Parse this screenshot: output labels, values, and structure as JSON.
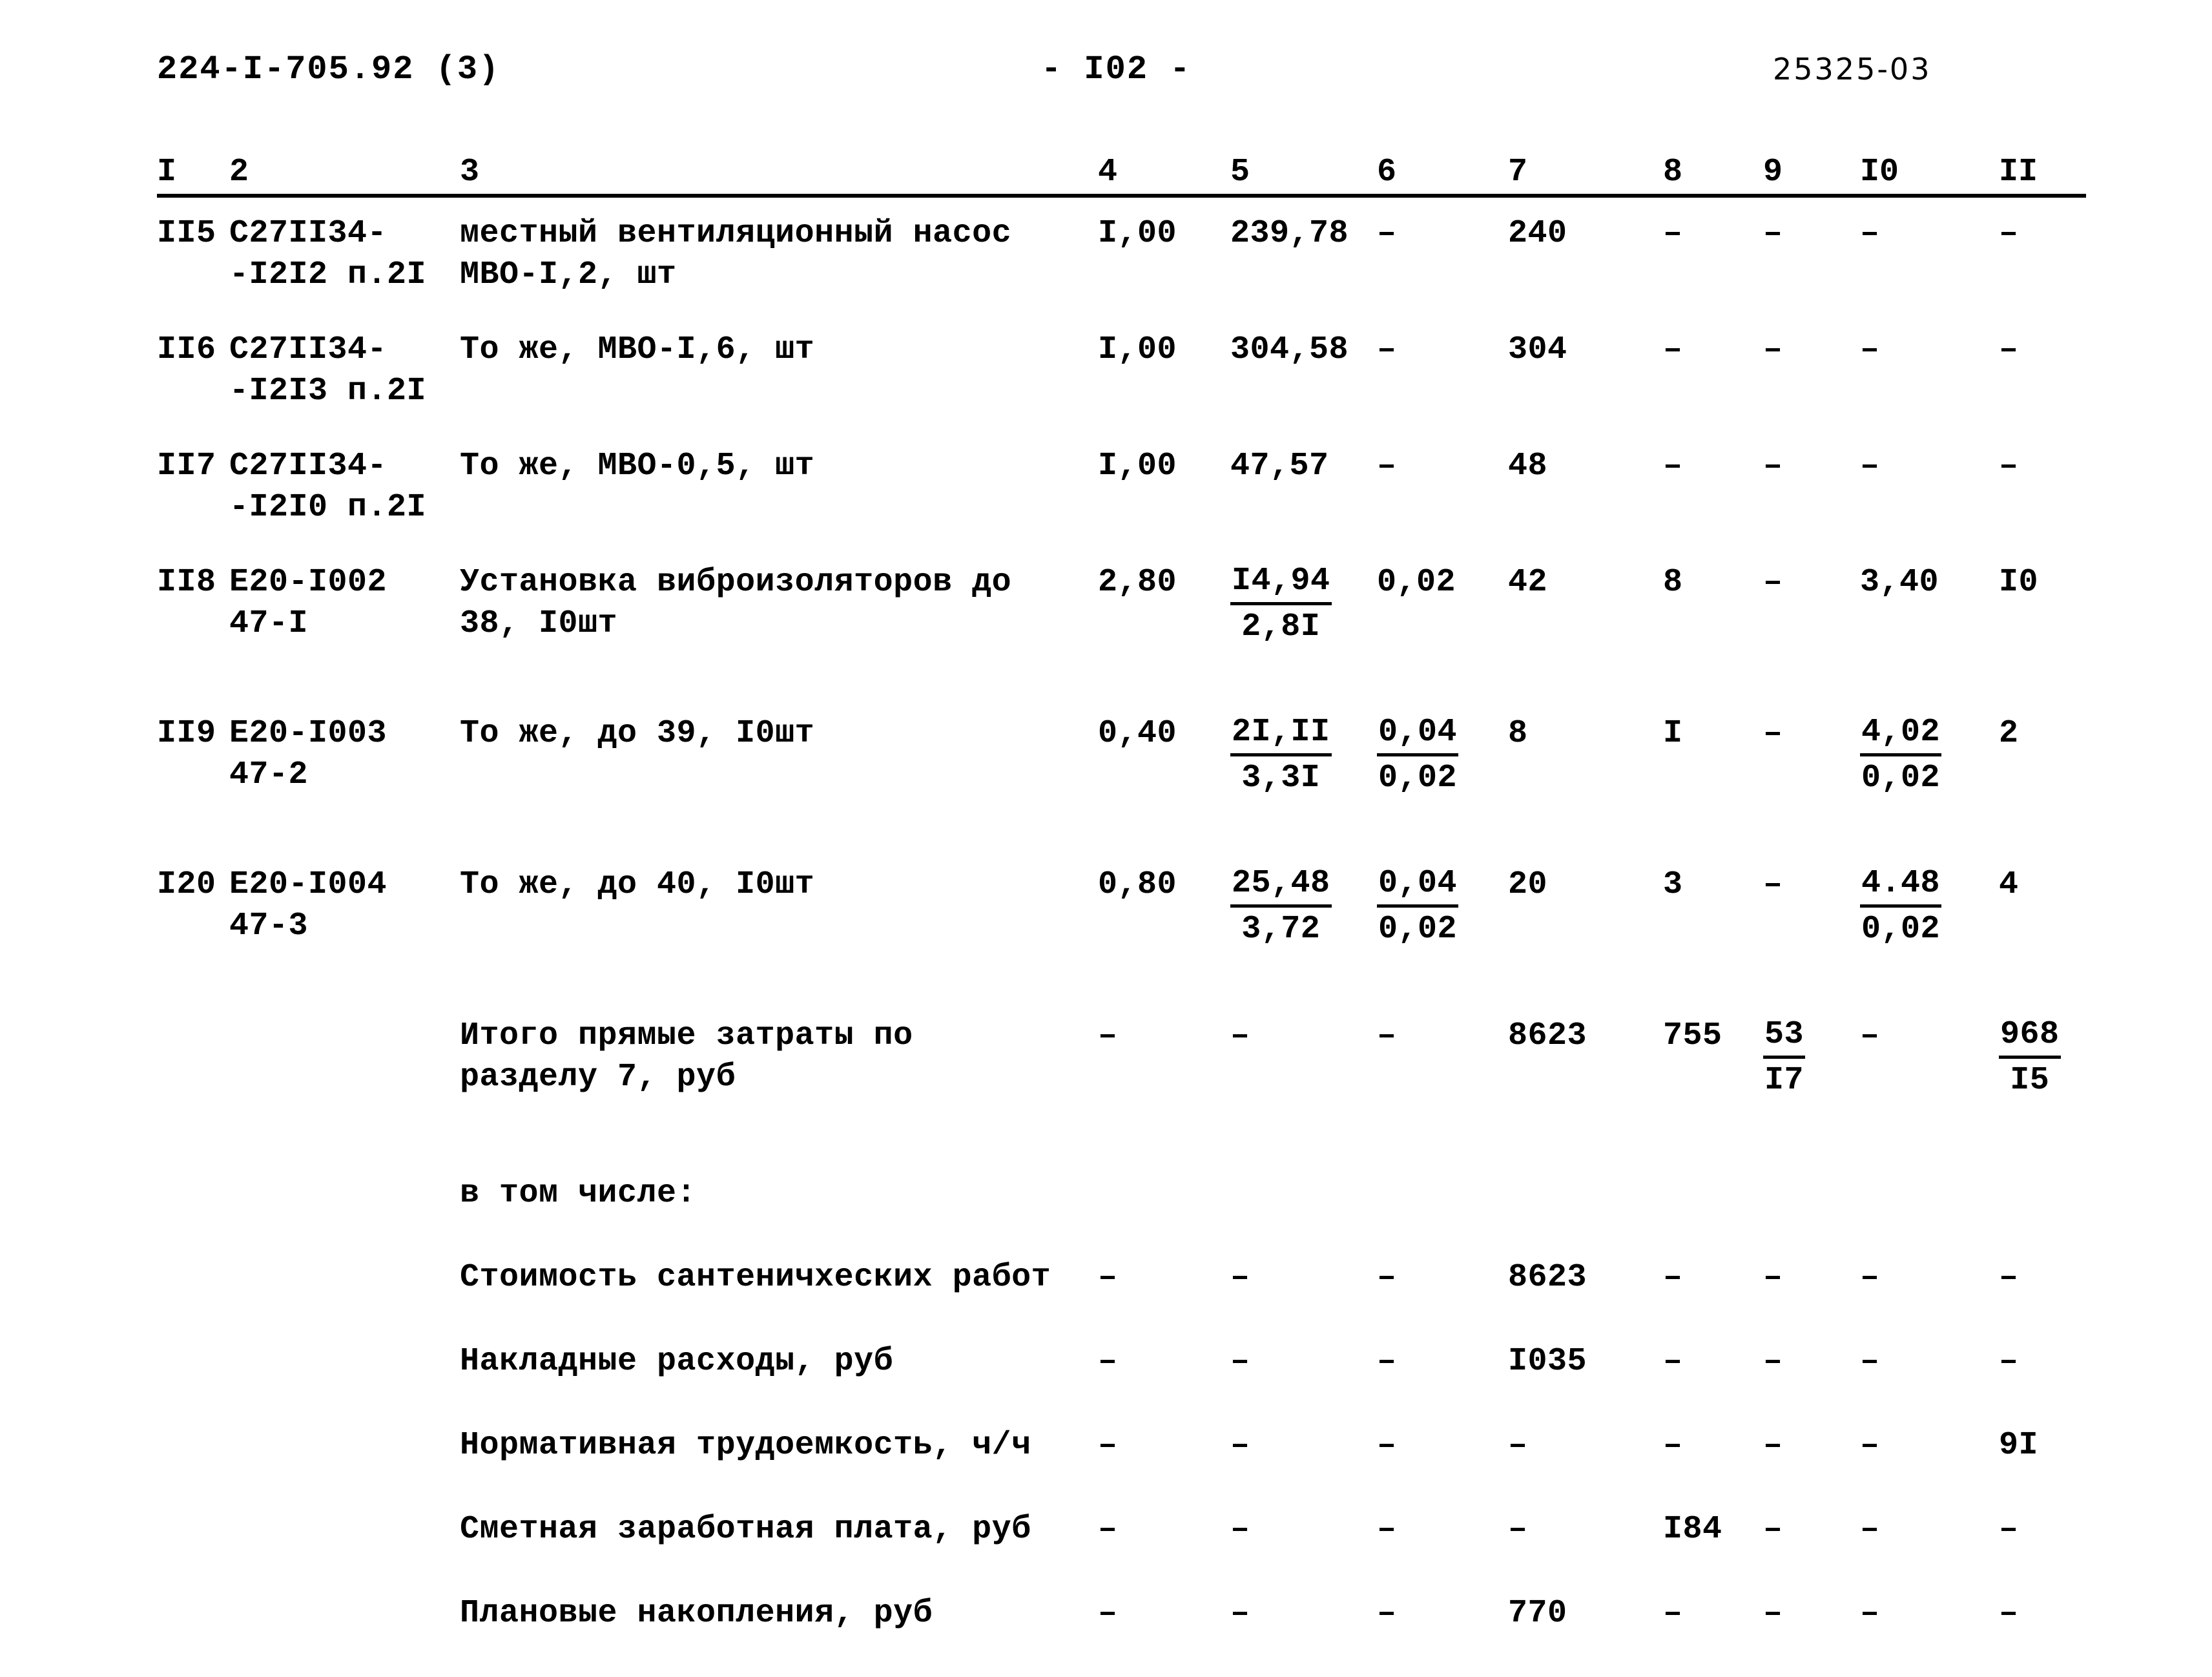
{
  "header": {
    "doc_code": "224-I-705.92 (3)",
    "page_marker": "- I02 -",
    "stamp_code": "25325-03"
  },
  "table": {
    "column_numbers": [
      "I",
      "2",
      "3",
      "4",
      "5",
      "6",
      "7",
      "8",
      "9",
      "I0",
      "II"
    ],
    "rows": [
      {
        "num": "II5",
        "code_l1": "С27II34-",
        "code_l2": "-I2I2 п.2I",
        "desc_l1": "местный вентиляционный насос",
        "desc_l2": "МВО-I,2, шт",
        "c4": "I,00",
        "c5_num": "239,78",
        "c5_den": "",
        "c6_num": "–",
        "c6_den": "",
        "c7": "240",
        "c8": "–",
        "c9_num": "–",
        "c9_den": "",
        "c10_num": "–",
        "c10_den": "",
        "c11_num": "–",
        "c11_den": ""
      },
      {
        "num": "II6",
        "code_l1": "С27II34-",
        "code_l2": "-I2I3 п.2I",
        "desc_l1": "То же, МВО-I,6, шт",
        "desc_l2": "",
        "c4": "I,00",
        "c5_num": "304,58",
        "c5_den": "",
        "c6_num": "–",
        "c6_den": "",
        "c7": "304",
        "c8": "–",
        "c9_num": "–",
        "c9_den": "",
        "c10_num": "–",
        "c10_den": "",
        "c11_num": "–",
        "c11_den": ""
      },
      {
        "num": "II7",
        "code_l1": "С27II34-",
        "code_l2": "-I2I0 п.2I",
        "desc_l1": "То же, МВО-0,5, шт",
        "desc_l2": "",
        "c4": "I,00",
        "c5_num": "47,57",
        "c5_den": "",
        "c6_num": "–",
        "c6_den": "",
        "c7": "48",
        "c8": "–",
        "c9_num": "–",
        "c9_den": "",
        "c10_num": "–",
        "c10_den": "",
        "c11_num": "–",
        "c11_den": ""
      },
      {
        "num": "II8",
        "code_l1": "Е20-I002",
        "code_l2": "47-I",
        "desc_l1": "Установка виброизоляторов до",
        "desc_l2": "38, I0шт",
        "c4": "2,80",
        "c5_num": "I4,94",
        "c5_den": "2,8I",
        "c6_num": "0,02",
        "c6_den": "",
        "c7": "42",
        "c8": "8",
        "c9_num": "–",
        "c9_den": "",
        "c10_num": "3,40",
        "c10_den": "",
        "c11_num": "I0",
        "c11_den": ""
      },
      {
        "num": "II9",
        "code_l1": "Е20-I003",
        "code_l2": "47-2",
        "desc_l1": "То же, до 39, I0шт",
        "desc_l2": "",
        "c4": "0,40",
        "c5_num": "2I,II",
        "c5_den": "3,3I",
        "c6_num": "0,04",
        "c6_den": "0,02",
        "c7": "8",
        "c8": "I",
        "c9_num": "–",
        "c9_den": "",
        "c10_num": "4,02",
        "c10_den": "0,02",
        "c11_num": "2",
        "c11_den": ""
      },
      {
        "num": "I20",
        "code_l1": "Е20-I004",
        "code_l2": "47-3",
        "desc_l1": "То же, до 40, I0шт",
        "desc_l2": "",
        "c4": "0,80",
        "c5_num": "25,48",
        "c5_den": "3,72",
        "c6_num": "0,04",
        "c6_den": "0,02",
        "c7": "20",
        "c8": "3",
        "c9_num": "–",
        "c9_den": "",
        "c10_num": "4.48",
        "c10_den": "0,02",
        "c11_num": "4",
        "c11_den": ""
      }
    ],
    "summary_rows": [
      {
        "label_l1": "Итого прямые затраты по",
        "label_l2": "разделу 7, руб",
        "c4": "–",
        "c5_num": "–",
        "c5_den": "",
        "c6_num": "–",
        "c6_den": "",
        "c7": "8623",
        "c8": "755",
        "c9_num": "53",
        "c9_den": "I7",
        "c10_num": "–",
        "c10_den": "",
        "c11_num": "968",
        "c11_den": "I5"
      },
      {
        "label_l1": "в том числе:",
        "label_l2": "",
        "c4": "",
        "c5_num": "",
        "c5_den": "",
        "c6_num": "",
        "c6_den": "",
        "c7": "",
        "c8": "",
        "c9_num": "",
        "c9_den": "",
        "c10_num": "",
        "c10_den": "",
        "c11_num": "",
        "c11_den": ""
      },
      {
        "label_l1": "Стоимость сантеничхеских работ",
        "label_l2": "",
        "c4": "–",
        "c5_num": "–",
        "c5_den": "",
        "c6_num": "–",
        "c6_den": "",
        "c7": "8623",
        "c8": "–",
        "c9_num": "–",
        "c9_den": "",
        "c10_num": "–",
        "c10_den": "",
        "c11_num": "–",
        "c11_den": ""
      },
      {
        "label_l1": "Накладные расходы, руб",
        "label_l2": "",
        "c4": "–",
        "c5_num": "–",
        "c5_den": "",
        "c6_num": "–",
        "c6_den": "",
        "c7": "I035",
        "c8": "–",
        "c9_num": "–",
        "c9_den": "",
        "c10_num": "–",
        "c10_den": "",
        "c11_num": "–",
        "c11_den": ""
      },
      {
        "label_l1": "Нормативная трудоемкость, ч/ч",
        "label_l2": "",
        "c4": "–",
        "c5_num": "–",
        "c5_den": "",
        "c6_num": "–",
        "c6_den": "",
        "c7": "–",
        "c8": "–",
        "c9_num": "–",
        "c9_den": "",
        "c10_num": "–",
        "c10_den": "",
        "c11_num": "9I",
        "c11_den": ""
      },
      {
        "label_l1": "Сметная заработная плата, руб",
        "label_l2": "",
        "c4": "–",
        "c5_num": "–",
        "c5_den": "",
        "c6_num": "–",
        "c6_den": "",
        "c7": "–",
        "c8": "I84",
        "c9_num": "–",
        "c9_den": "",
        "c10_num": "–",
        "c10_den": "",
        "c11_num": "–",
        "c11_den": ""
      },
      {
        "label_l1": "Плановые накопления, руб",
        "label_l2": "",
        "c4": "–",
        "c5_num": "–",
        "c5_den": "",
        "c6_num": "–",
        "c6_den": "",
        "c7": "770",
        "c8": "–",
        "c9_num": "–",
        "c9_den": "",
        "c10_num": "–",
        "c10_den": "",
        "c11_num": "–",
        "c11_den": ""
      }
    ]
  }
}
